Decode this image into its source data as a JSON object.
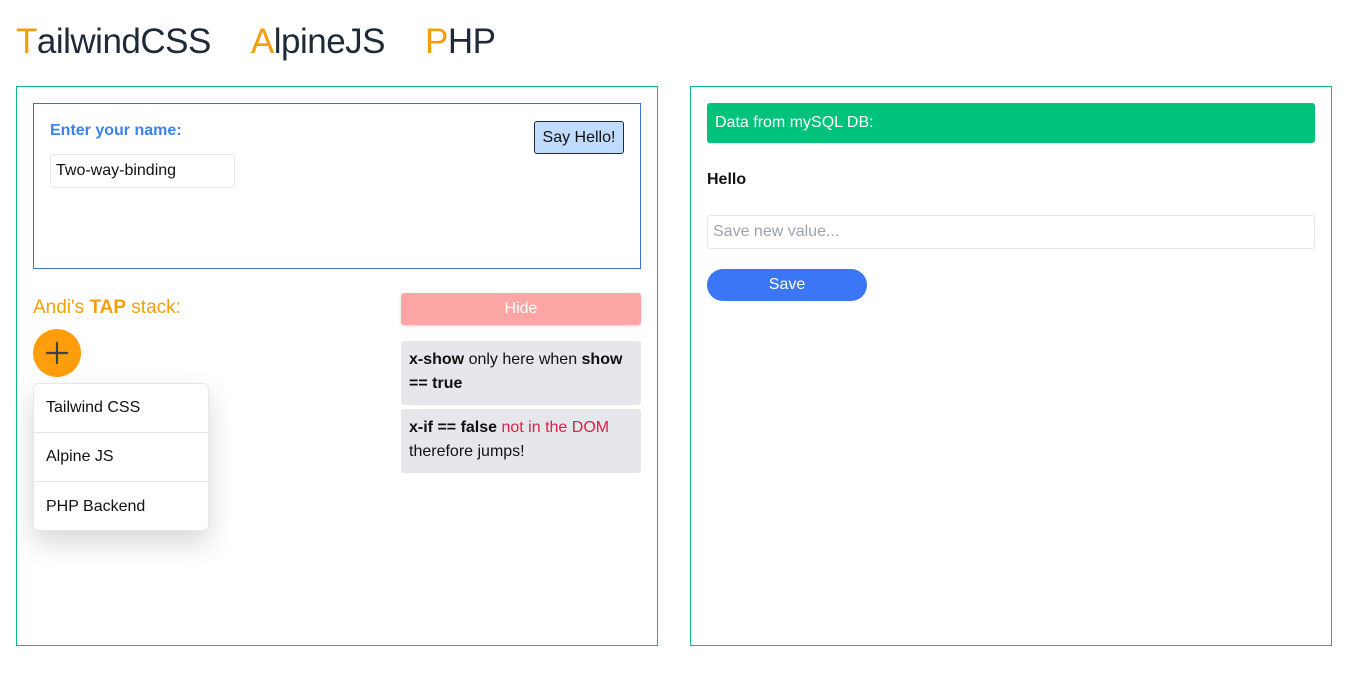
{
  "header": {
    "brands": [
      {
        "initial": "T",
        "rest": "ailwindCSS"
      },
      {
        "initial": "A",
        "rest": "lpineJS"
      },
      {
        "initial": "P",
        "rest": "HP"
      }
    ]
  },
  "left_panel": {
    "name_card": {
      "label": "Enter your name:",
      "input_value": "Two-way-binding",
      "button_label": "Say Hello!"
    },
    "stack": {
      "title_prefix": "Andi's ",
      "title_bold": "TAP",
      "title_suffix": " stack:",
      "add_icon": "plus-icon",
      "items": [
        {
          "label": "Tailwind CSS"
        },
        {
          "label": "Alpine JS"
        },
        {
          "label": "PHP Backend"
        }
      ]
    },
    "toggle": {
      "hide_label": "Hide",
      "show_note": {
        "bold1": "x-show",
        "text1": " only here when ",
        "bold2": "show == true"
      },
      "if_note": {
        "bold1": "x-if == false",
        "red": " not in the DOM",
        "text2": " therefore jumps!"
      }
    }
  },
  "right_panel": {
    "header": "Data from mySQL DB:",
    "value": "Hello",
    "input_placeholder": "Save new value...",
    "input_value": "",
    "save_label": "Save"
  },
  "colors": {
    "accent_orange": "#f59e0b",
    "panel_border": "#10b981",
    "db_header": "#00c27a",
    "save_button": "#3b76f6",
    "hide_button": "#fca5a5",
    "say_hello_button": "#bfdbfe",
    "label_blue": "#3b82f6",
    "note_red": "#e11d48"
  }
}
